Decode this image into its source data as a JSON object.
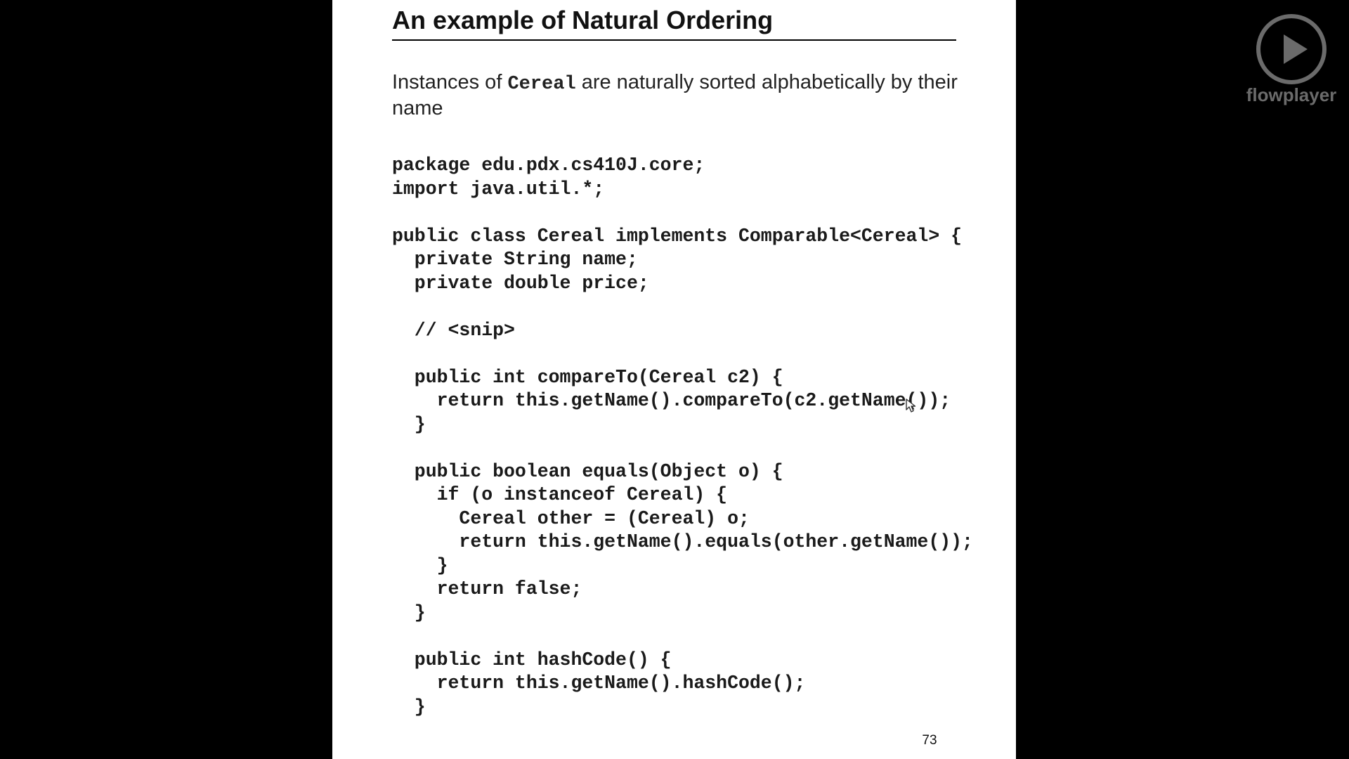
{
  "slide": {
    "title": "An example of Natural Ordering",
    "intro": {
      "before": "Instances of ",
      "class_name": "Cereal",
      "after": " are naturally sorted alphabetically by their name"
    },
    "code": "package edu.pdx.cs410J.core;\nimport java.util.*;\n\npublic class Cereal implements Comparable<Cereal> {\n  private String name;\n  private double price;\n\n  // <snip>\n\n  public int compareTo(Cereal c2) {\n    return this.getName().compareTo(c2.getName());\n  }\n\n  public boolean equals(Object o) {\n    if (o instanceof Cereal) {\n      Cereal other = (Cereal) o;\n      return this.getName().equals(other.getName());\n    }\n    return false;\n  }\n\n  public int hashCode() {\n    return this.getName().hashCode();\n  }",
    "page_number": "73"
  },
  "player": {
    "brand": "flowplayer",
    "play_icon": "play-icon",
    "logo_color": "#6b6b6b"
  },
  "colors": {
    "background": "#000000",
    "slide": "#ffffff",
    "text": "#1a1a1a"
  }
}
